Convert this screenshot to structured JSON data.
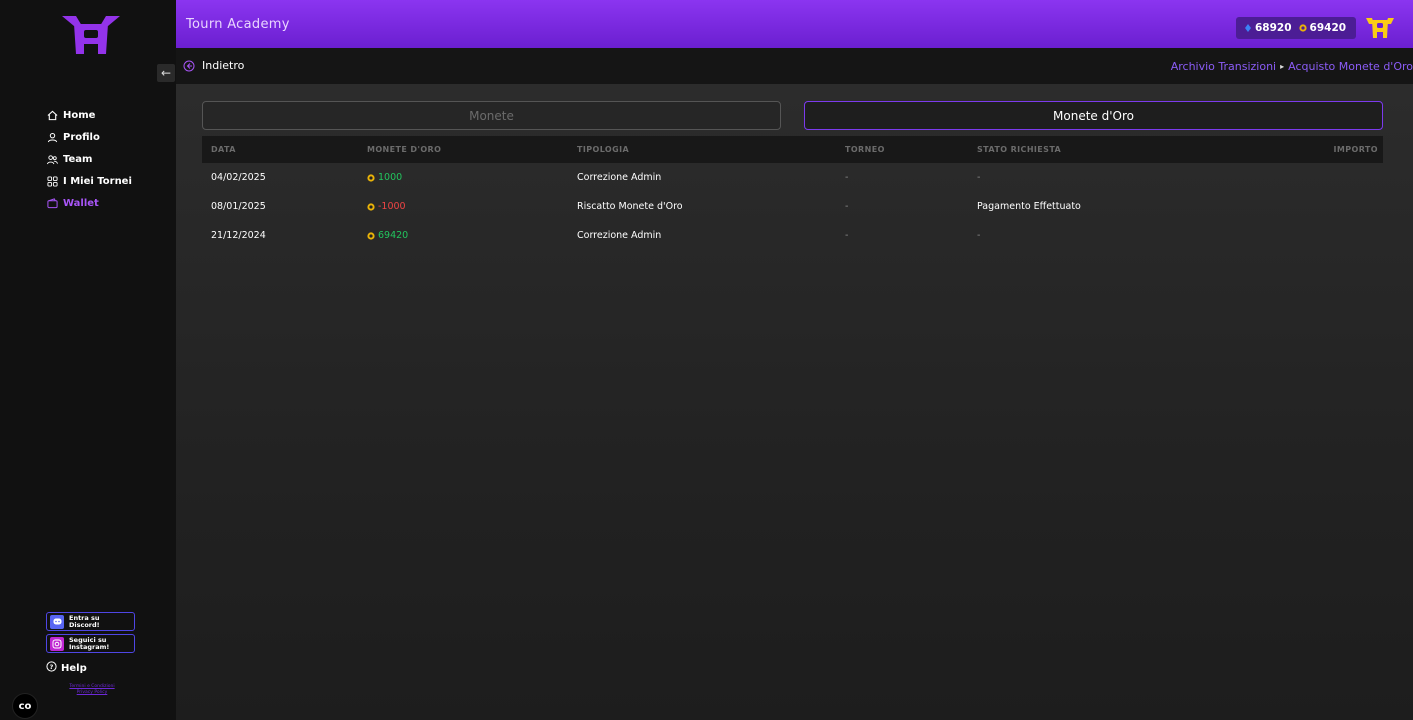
{
  "app_title": "Tourn Academy",
  "colors": {
    "accent": "#8b35f0",
    "positive": "#22c55e",
    "negative": "#ef4444",
    "gold": "#eab308",
    "blue_coin": "#3b82f6"
  },
  "header": {
    "coins_blue": "68920",
    "coins_gold": "69420"
  },
  "subbar": {
    "back_label": "Indietro",
    "breadcrumb": [
      "Archivio Transizioni",
      "Acquisto Monete d'Oro"
    ]
  },
  "sidebar": {
    "items": [
      {
        "label": "Home",
        "icon": "home-icon"
      },
      {
        "label": "Profilo",
        "icon": "user-icon"
      },
      {
        "label": "Team",
        "icon": "team-icon"
      },
      {
        "label": "I Miei Tornei",
        "icon": "grid-icon"
      },
      {
        "label": "Wallet",
        "icon": "wallet-icon",
        "active": true
      }
    ],
    "discord": [
      "Entra su",
      "Discord!"
    ],
    "instagram": [
      "Seguici su",
      "Instagram!"
    ],
    "help": "Help",
    "legal": [
      "Termini e Condizioni",
      "Privacy Policy"
    ],
    "cookie": "co"
  },
  "tabs": {
    "monete": "Monete",
    "oro": "Monete d'Oro"
  },
  "table": {
    "headers": [
      "DATA",
      "MONETE D'ORO",
      "TIPOLOGIA",
      "TORNEO",
      "STATO RICHIESTA",
      "IMPORTO"
    ],
    "rows": [
      {
        "data": "04/02/2025",
        "monete": "1000",
        "sign": "pos",
        "tipologia": "Correzione Admin",
        "torneo": "-",
        "stato": "-"
      },
      {
        "data": "08/01/2025",
        "monete": "-1000",
        "sign": "neg",
        "tipologia": "Riscatto Monete d'Oro",
        "torneo": "-",
        "stato": "Pagamento Effettuato"
      },
      {
        "data": "21/12/2024",
        "monete": "69420",
        "sign": "pos",
        "tipologia": "Correzione Admin",
        "torneo": "-",
        "stato": "-"
      }
    ]
  }
}
